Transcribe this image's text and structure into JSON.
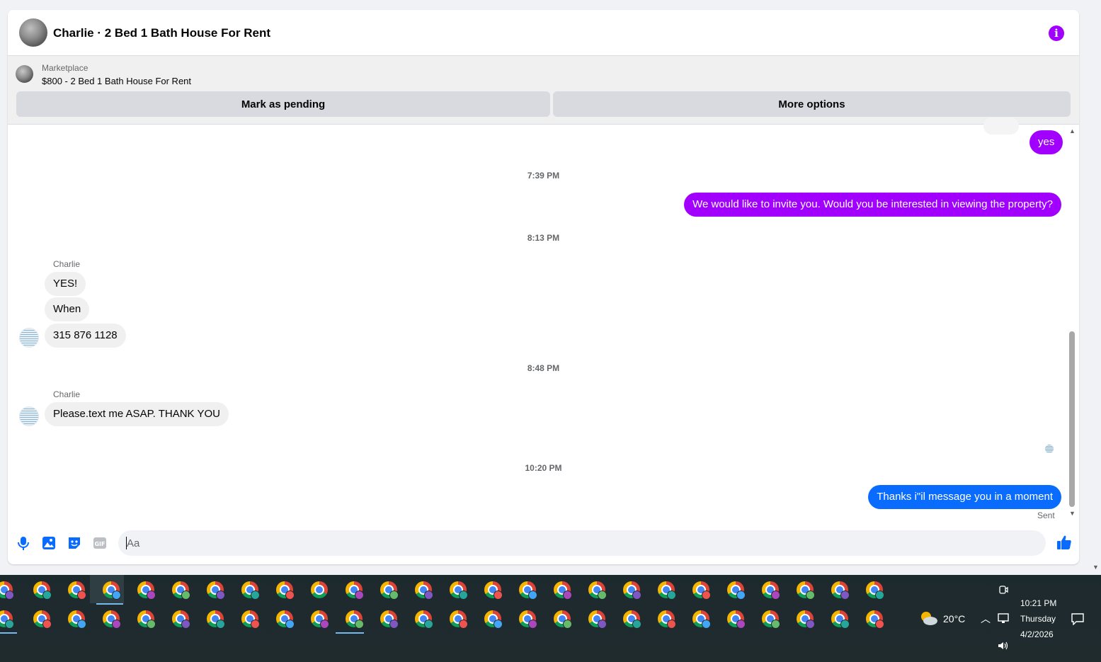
{
  "header": {
    "title": "Charlie · 2 Bed 1 Bath House For Rent",
    "info_icon": "info-icon"
  },
  "listing": {
    "label": "Marketplace",
    "price_title": "$800 - 2 Bed 1 Bath House For Rent",
    "mark_pending": "Mark as pending",
    "more_options": "More options"
  },
  "messages": {
    "out1": "yes",
    "ts1": "7:39 PM",
    "out2": "We would like to invite you. Would you be interested in viewing the property?",
    "ts2": "8:13 PM",
    "sender1": "Charlie",
    "in1": "YES!",
    "in2": "When",
    "in3": "315 876 1128",
    "ts3": "8:48 PM",
    "sender2": "Charlie",
    "in4": "Please.text me  ASAP. THANK YOU",
    "ts4": "10:20 PM",
    "out3": "Thanks i\"il message you in a moment",
    "status": "Sent"
  },
  "composer": {
    "placeholder": "Aa",
    "gif_label": "GIF"
  },
  "colors": {
    "accent": "#a100ff",
    "sent_blue": "#0a6cff",
    "incoming": "#f0f0f0"
  },
  "taskbar": {
    "weather": "20°C",
    "time": "10:21 PM",
    "day": "Thursday",
    "date": "4/2/2026"
  }
}
